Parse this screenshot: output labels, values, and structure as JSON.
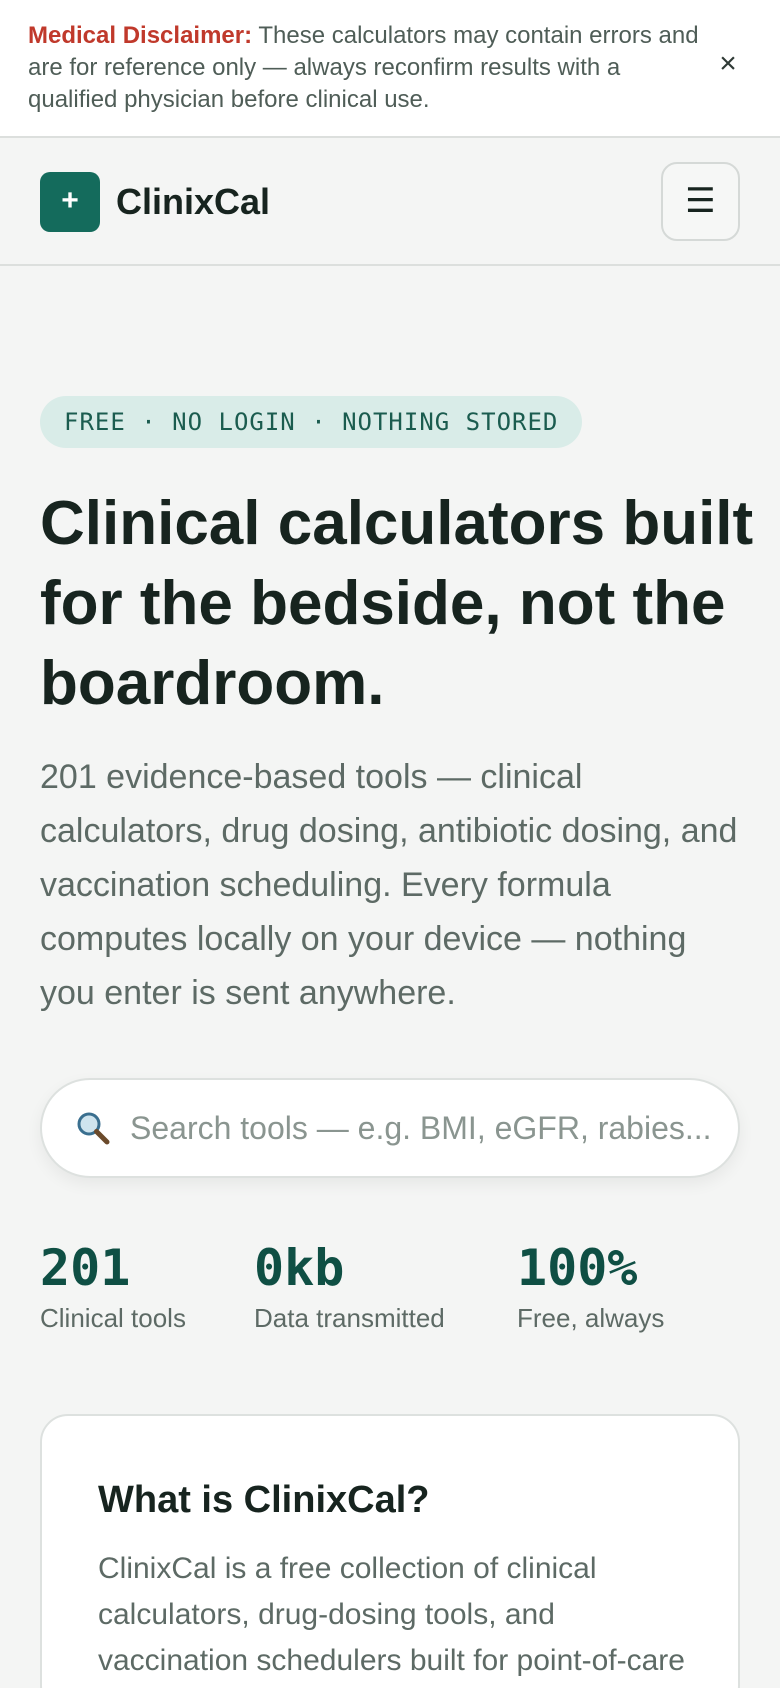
{
  "disclaimer": {
    "label": "Medical Disclaimer:",
    "text": "These calculators may contain errors and are for reference only — always reconfirm results with a qualified physician before clinical use.",
    "close_icon": "×"
  },
  "header": {
    "logo_icon": "+",
    "brand": "ClinixCal",
    "menu_icon": "☰"
  },
  "hero": {
    "pill": "FREE · NO LOGIN · NOTHING STORED",
    "title": "Clinical calculators built for the bedside, not the boardroom.",
    "description": "201 evidence-based tools — clinical calculators, drug dosing, antibiotic dosing, and vaccination scheduling. Every formula computes locally on your device — nothing you enter is sent anywhere."
  },
  "search": {
    "icon": "search-icon",
    "value": "",
    "placeholder": "Search tools — e.g. BMI, eGFR, rabies..."
  },
  "stats": [
    {
      "value": "201",
      "label": "Clinical tools"
    },
    {
      "value": "0kb",
      "label": "Data transmitted"
    },
    {
      "value": "100%",
      "label": "Free, always"
    }
  ],
  "about": {
    "title": "What is ClinixCal?",
    "body": "ClinixCal is a free collection of clinical calculators, drug-dosing tools, and vaccination schedulers built for point-of-care use."
  },
  "colors": {
    "accent": "#146b5c",
    "stat_value": "#0f4f44",
    "disclaimer_label": "#c0392b",
    "pill_background": "#d9ece8",
    "page_background": "#f4f5f4"
  }
}
